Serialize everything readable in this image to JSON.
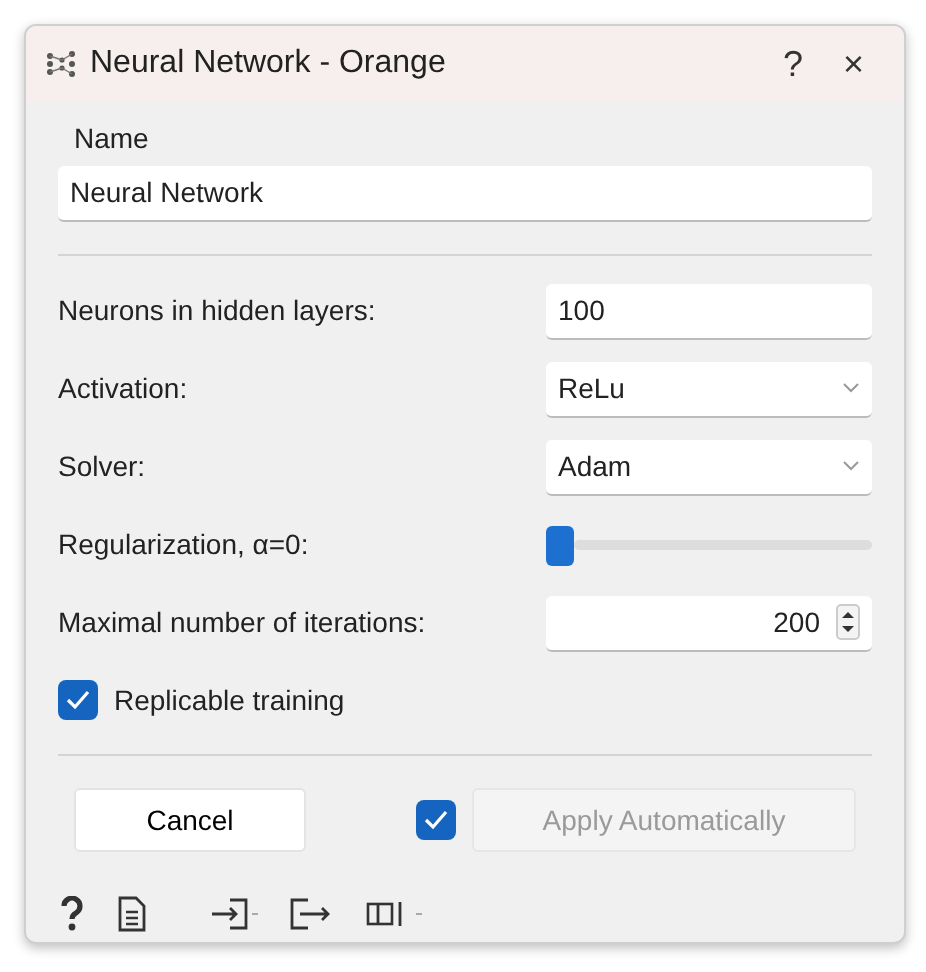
{
  "window": {
    "title": "Neural Network - Orange",
    "help": "?",
    "close": "×"
  },
  "name_box": {
    "label": "Name",
    "value": "Neural Network"
  },
  "params": [
    {
      "kind": "text",
      "label": "Neurons in hidden layers:",
      "value": "100"
    },
    {
      "kind": "combo",
      "label": "Activation:",
      "value": "ReLu"
    },
    {
      "kind": "combo",
      "label": "Solver:",
      "value": "Adam"
    },
    {
      "kind": "slider",
      "label": "Regularization, α=0:",
      "level": 0.0
    },
    {
      "kind": "spin",
      "label": "Maximal number of iterations:",
      "value": "200"
    }
  ],
  "replicable": {
    "label": "Replicable training",
    "checked": true
  },
  "footer": {
    "cancel": "Cancel",
    "auto_apply": {
      "checked": true,
      "label": "Apply Automatically",
      "disabled": true
    }
  }
}
